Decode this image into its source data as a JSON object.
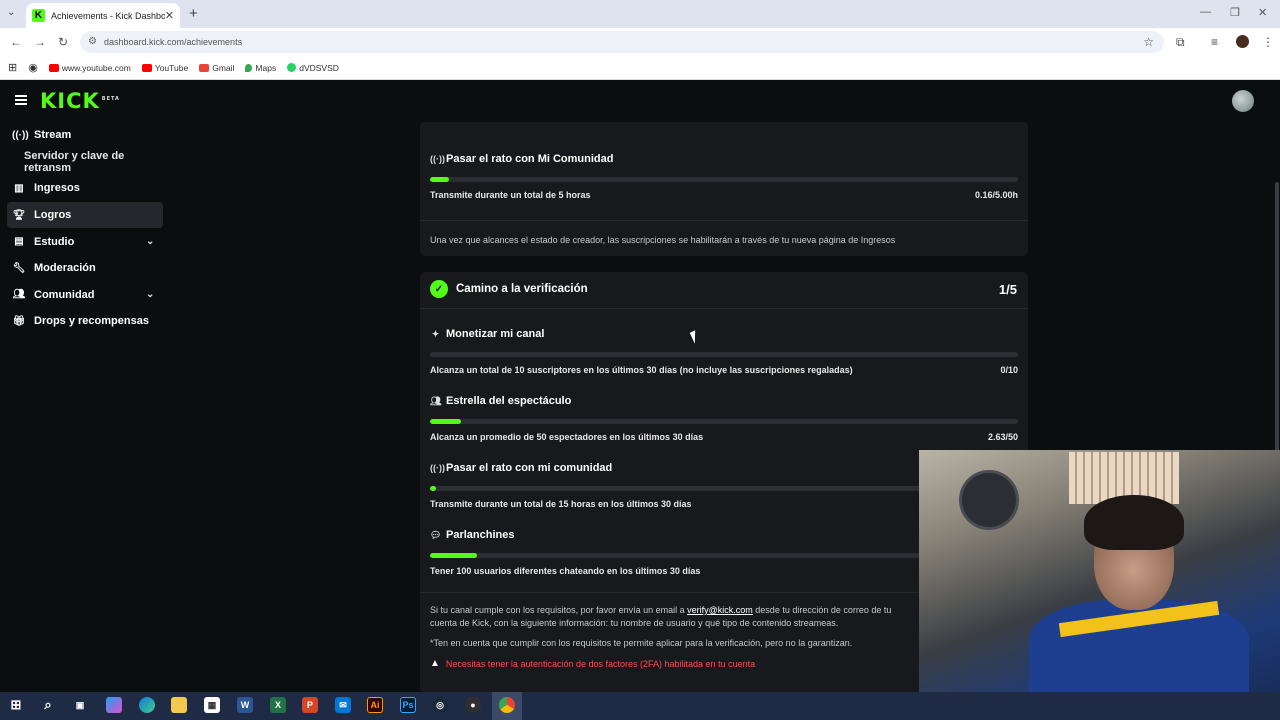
{
  "browser": {
    "tab_title": "Achievements - Kick Dashboard",
    "url": "dashboard.kick.com/achievements",
    "bookmarks": [
      {
        "label": "www.youtube.com",
        "color": "#ff0000"
      },
      {
        "label": "YouTube",
        "color": "#ff0000"
      },
      {
        "label": "Gmail",
        "color": "#ea4335"
      },
      {
        "label": "Maps",
        "color": "#34a853"
      },
      {
        "label": "dVDSVSD",
        "color": "#25d366"
      }
    ]
  },
  "app": {
    "logo": "KICK",
    "logo_tag": "BETA",
    "accent": "#53fc18"
  },
  "sidebar": {
    "items": [
      {
        "label": "Stream",
        "icon": "broadcast-icon"
      },
      {
        "label": "Servidor y clave de retransm"
      },
      {
        "label": "Ingresos",
        "icon": "chart-icon"
      },
      {
        "label": "Logros",
        "icon": "trophy-icon"
      },
      {
        "label": "Estudio",
        "icon": "studio-icon"
      },
      {
        "label": "Moderación",
        "icon": "wrench-icon"
      },
      {
        "label": "Comunidad",
        "icon": "community-icon"
      },
      {
        "label": "Drops y recompensas",
        "icon": "gift-icon"
      }
    ]
  },
  "creator_card": {
    "title": "Pasar el rato con Mi Comunidad",
    "description": "Transmite durante un total de 5 horas",
    "value": "0.16/5.00h",
    "progress": 0.032,
    "note": "Una vez que alcances el estado de creador, las suscripciones se habilitarán a través de tu nueva página de Ingresos"
  },
  "verification": {
    "title": "Camino a la verificación",
    "count": "1/5",
    "achievements": [
      {
        "title": "Monetizar mi canal",
        "icon": "sparkle-icon",
        "description": "Alcanza un total de 10 suscriptores en los últimos 30 días (no incluye las suscripciones regaladas)",
        "value": "0/10",
        "progress": 0.0
      },
      {
        "title": "Estrella del espectáculo",
        "icon": "people-icon",
        "description": "Alcanza un promedio de 50 espectadores en los últimos 30 días",
        "value": "2.63/50",
        "progress": 0.0526
      },
      {
        "title": "Pasar el rato con mi comunidad",
        "icon": "broadcast-icon",
        "description": "Transmite durante un total de 15 horas en los últimos 30 días",
        "value": "",
        "progress": 0.011
      },
      {
        "title": "Parlanchines",
        "icon": "chat-icon",
        "description": "Tener 100 usuarios diferentes chateando en los últimos 30 días",
        "value": "",
        "progress": 0.08
      }
    ],
    "info_before_link": "Si tu canal cumple con los requisitos, por favor envía un email a ",
    "info_link": "verify@kick.com",
    "info_after_link": " desde tu dirección de correo de tu cuenta de Kick, con la siguiente información: tu nombre de usuario y qué tipo de contenido streameas.",
    "disclaimer": "*Ten en cuenta que cumplir con los requisitos te permite aplicar para la verificación, pero no la garantizan.",
    "warning": "Necesitas tener la autenticación de dos factores (2FA) habilitada en tu cuenta"
  },
  "taskbar": {
    "icons": [
      "windows-start-icon",
      "search-icon",
      "task-view-icon",
      "copilot-icon",
      "edge-icon",
      "file-explorer-icon",
      "store-icon",
      "word-icon",
      "excel-icon",
      "powerpoint-icon",
      "outlook-icon",
      "illustrator-icon",
      "photoshop-icon",
      "steam-icon",
      "obs-icon",
      "chrome-icon"
    ],
    "labels": {
      "word": "W",
      "excel": "X",
      "powerpoint": "P",
      "illustrator": "Ai",
      "photoshop": "Ps"
    }
  }
}
